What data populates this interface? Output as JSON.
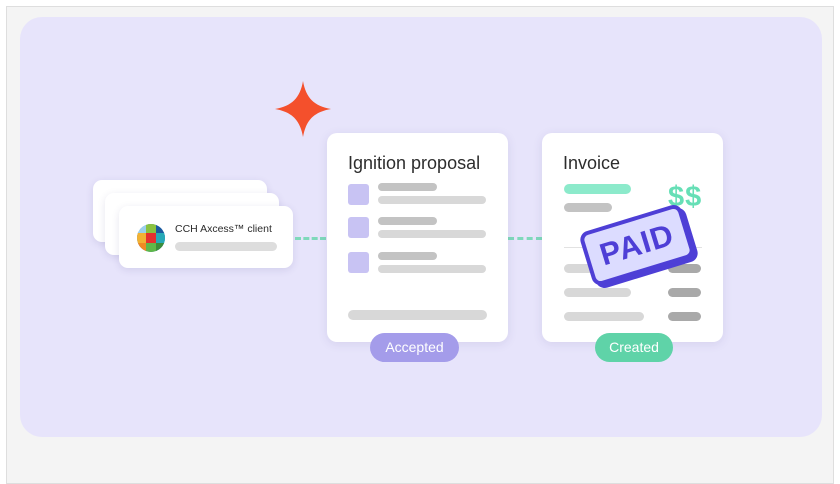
{
  "client": {
    "title": "CCH Axcess™ client"
  },
  "proposal": {
    "title": "Ignition proposal",
    "status": "Accepted"
  },
  "invoice": {
    "title": "Invoice",
    "amount_symbol": "$$",
    "stamp": "PAID",
    "status": "Created"
  },
  "colors": {
    "panel": "#e7e4fb",
    "sparkle": "#f4502c",
    "accepted": "#a49cea",
    "created": "#5fd3a8",
    "stamp": "#4e3fd6",
    "connector": "#7fd9bb"
  },
  "icons": {
    "sparkle": "sparkle-icon",
    "client_logo": "cch-logo-icon"
  }
}
